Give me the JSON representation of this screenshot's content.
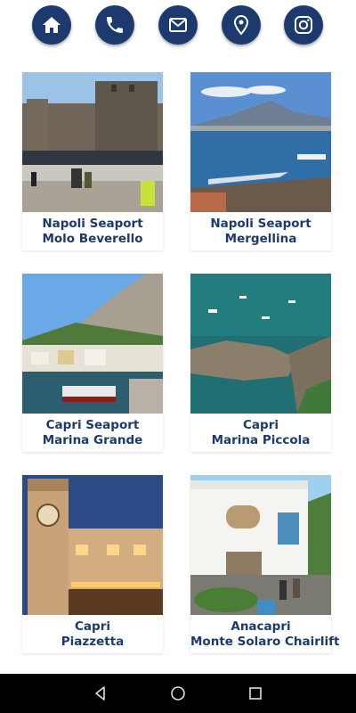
{
  "header": {
    "icons": [
      {
        "name": "home-icon"
      },
      {
        "name": "phone-icon"
      },
      {
        "name": "mail-icon"
      },
      {
        "name": "location-pin-icon"
      },
      {
        "name": "instagram-icon"
      }
    ],
    "accent_color": "#1d3a6e"
  },
  "locations": [
    {
      "line1": "Napoli Seaport",
      "line2": "Molo Beverello"
    },
    {
      "line1": "Napoli Seaport",
      "line2": "Mergellina"
    },
    {
      "line1": "Capri Seaport",
      "line2": "Marina Grande"
    },
    {
      "line1": "Capri",
      "line2": "Marina Piccola"
    },
    {
      "line1": "Capri",
      "line2": "Piazzetta"
    },
    {
      "line1": "Anacapri",
      "line2": "Monte Solaro Chairlift"
    }
  ],
  "system_nav": {
    "icons": [
      "back-icon",
      "home-circle-icon",
      "recents-icon"
    ]
  }
}
